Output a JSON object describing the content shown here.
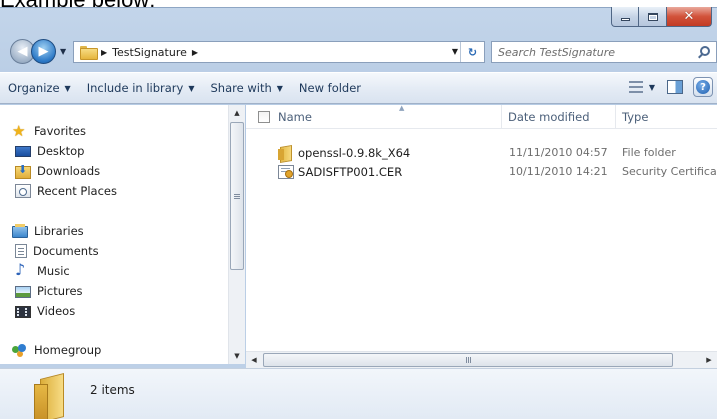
{
  "caption": "Example below:",
  "window": {
    "caption_buttons": {
      "minimize": "–",
      "maximize": "",
      "close": "✕"
    }
  },
  "address": {
    "crumbs": [
      "TestSignature"
    ],
    "search_placeholder": "Search TestSignature"
  },
  "toolbar": {
    "organize": "Organize",
    "include_in_library": "Include in library",
    "share_with": "Share with",
    "new_folder": "New folder"
  },
  "sidebar": {
    "favorites": {
      "label": "Favorites",
      "items": [
        "Desktop",
        "Downloads",
        "Recent Places"
      ]
    },
    "libraries": {
      "label": "Libraries",
      "items": [
        "Documents",
        "Music",
        "Pictures",
        "Videos"
      ]
    },
    "homegroup": {
      "label": "Homegroup"
    }
  },
  "file_list": {
    "columns": [
      "Name",
      "Date modified",
      "Type"
    ],
    "rows": [
      {
        "name": "openssl-0.9.8k_X64",
        "date": "11/11/2010 04:57",
        "type": "File folder",
        "icon": "folder-icon"
      },
      {
        "name": "SADISFTP001.CER",
        "date": "10/11/2010 14:21",
        "type": "Security Certificate",
        "icon": "certificate-icon"
      }
    ]
  },
  "status": {
    "item_count": "2 items"
  },
  "colors": {
    "frame": "#bfd2e8",
    "close_button": "#c23b24",
    "toolbar_text": "#1e395b",
    "header_text": "#4c607a"
  }
}
